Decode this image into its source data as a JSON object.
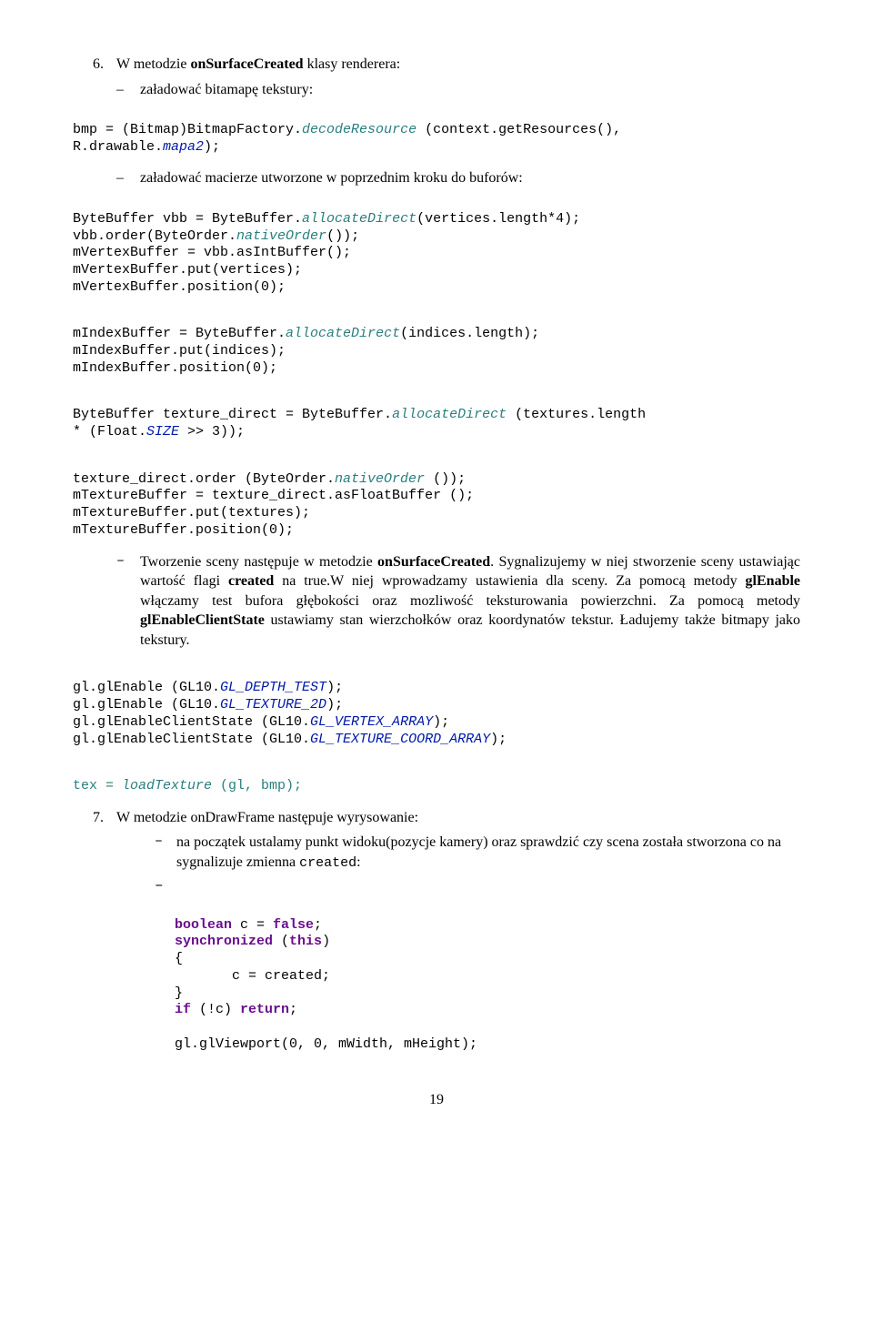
{
  "item6_num": "6.",
  "item6_head_a": "W metodzie ",
  "item6_head_b": "onSurfaceCreated",
  "item6_head_c": " klasy renderera:",
  "item6_bullet1": "załadować bitamapę tekstury:",
  "code1_l1_a": "bmp = (Bitmap)BitmapFactory.",
  "code1_l1_b": "decodeResource",
  "code1_l1_c": " (context.getResources(), ",
  "code1_l2_a": "R.drawable.",
  "code1_l2_b": "mapa2",
  "code1_l2_c": ");",
  "item6_bullet2": "załadować macierze utworzone w poprzednim kroku do buforów:",
  "code2_l1_a": "ByteBuffer vbb = ByteBuffer.",
  "code2_l1_b": "allocateDirect",
  "code2_l1_c": "(vertices.length*4);",
  "code2_l2_a": "vbb.order(ByteOrder.",
  "code2_l2_b": "nativeOrder",
  "code2_l2_c": "());",
  "code2_l3": "mVertexBuffer = vbb.asIntBuffer();",
  "code2_l4": "mVertexBuffer.put(vertices);",
  "code2_l5": "mVertexBuffer.position(0);",
  "code3_l1_a": "mIndexBuffer = ByteBuffer.",
  "code3_l1_b": "allocateDirect",
  "code3_l1_c": "(indices.length);",
  "code3_l2": "mIndexBuffer.put(indices);",
  "code3_l3": "mIndexBuffer.position(0);",
  "code4_l1_a": "ByteBuffer texture_direct = ByteBuffer.",
  "code4_l1_b": "allocateDirect",
  "code4_l1_c": " (textures.length ",
  "code4_l2_a": "* (Float.",
  "code4_l2_b": "SIZE",
  "code4_l2_c": " >> 3));",
  "code5_l1_a": "texture_direct.order (ByteOrder.",
  "code5_l1_b": "nativeOrder",
  "code5_l1_c": " ());",
  "code5_l2": "mTextureBuffer = texture_direct.asFloatBuffer ();",
  "code5_l3": "mTextureBuffer.put(textures);",
  "code5_l4": "mTextureBuffer.position(0);",
  "para1_a": "Tworzenie sceny następuje  w metodzie ",
  "para1_b": "onSurfaceCreated",
  "para1_c": ". Sygnalizujemy w niej stworzenie sceny ustawiając wartość flagi ",
  "para1_d": "created",
  "para1_e": " na true.W niej wprowadzamy ustawienia dla sceny. Za pomocą metody ",
  "para1_f": "glEnable",
  "para1_g": " włączamy test bufora głębokości oraz mozliwość teksturowania powierzchni. Za pomocą metody ",
  "para1_h": "glEnableClientState",
  "para1_i": " ustawiamy stan wierzchołków oraz koordynatów tekstur. Ładujemy także bitmapy jako tekstury.",
  "code6_l1_a": "gl.glEnable (GL10.",
  "code6_l1_b": "GL_DEPTH_TEST",
  "code6_l1_c": ");",
  "code6_l2_a": "gl.glEnable (GL10.",
  "code6_l2_b": "GL_TEXTURE_2D",
  "code6_l2_c": ");",
  "code6_l3_a": "gl.glEnableClientState (GL10.",
  "code6_l3_b": "GL_VERTEX_ARRAY",
  "code6_l3_c": ");",
  "code6_l4_a": "gl.glEnableClientState (GL10.",
  "code6_l4_b": "GL_TEXTURE_COORD_ARRAY",
  "code6_l4_c": ");",
  "code7_a": "tex = ",
  "code7_b": "loadTexture",
  "code7_c": " (gl, bmp);",
  "item7_num": "7.",
  "item7_txt": "W metodzie onDrawFrame  następuje wyrysowanie:",
  "item7_b1_a": "na początek ustalamy punkt widoku(pozycje kamery) oraz sprawdzić czy scena została stworzona co na sygnalizuje zmienna ",
  "item7_b1_b": "created",
  "item7_b1_c": ":",
  "item7_b2": "",
  "code8_l1_a": "boolean",
  "code8_l1_b": " c = ",
  "code8_l1_c": "false",
  "code8_l1_d": ";",
  "code8_l2_a": "synchronized",
  "code8_l2_b": " (",
  "code8_l2_c": "this",
  "code8_l2_d": ")",
  "code8_l3": "{",
  "code8_l4": "       c = created;",
  "code8_l5": "}",
  "code8_l6_a": "if",
  "code8_l6_b": " (!c) ",
  "code8_l6_c": "return",
  "code8_l6_d": ";",
  "code8_l8": "gl.glViewport(0, 0, mWidth, mHeight);",
  "page_number": "19"
}
